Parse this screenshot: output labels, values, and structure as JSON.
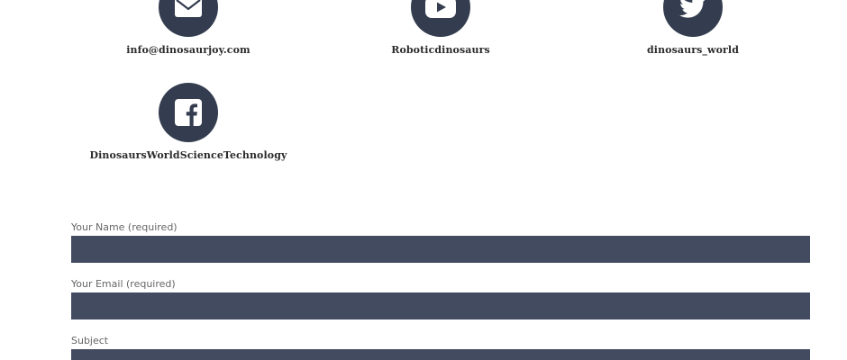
{
  "contacts": [
    {
      "icon": "envelope-icon",
      "label": "info@dinosaurjoy.com"
    },
    {
      "icon": "youtube-icon",
      "label": "Roboticdinosaurs"
    },
    {
      "icon": "twitter-icon",
      "label": "dinosaurs_world"
    },
    {
      "icon": "facebook-icon",
      "label": "DinosaursWorldScienceTechnology"
    }
  ],
  "form": {
    "name_label": "Your Name (required)",
    "name_value": "",
    "email_label": "Your Email (required)",
    "email_value": "",
    "subject_label": "Subject",
    "subject_value": ""
  },
  "colors": {
    "icon_circle": "#343d4f",
    "input_bg": "#434b61",
    "label_text": "#666666",
    "contact_text": "#2b2b2b"
  }
}
